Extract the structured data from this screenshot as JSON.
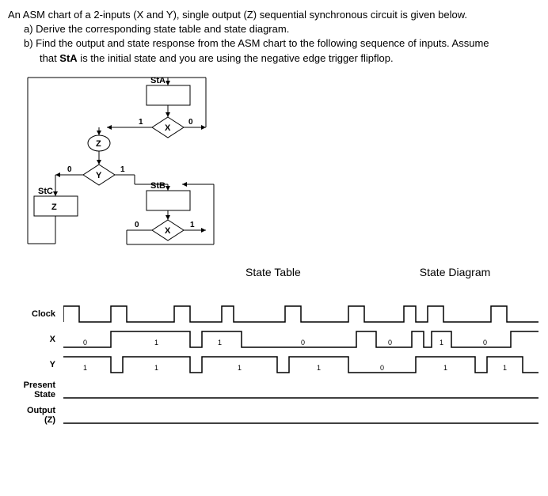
{
  "header": {
    "intro": "An ASM chart of a 2-inputs (X and Y), single output (Z) sequential synchronous circuit is given below.",
    "item_a": "a) Derive the corresponding state table and state diagram.",
    "item_b": "b) Find the output and state response from the ASM chart to the following sequence of inputs. Assume",
    "item_b_cont": "that StA is the initial state and you are using the negative edge trigger flipflop."
  },
  "asm": {
    "state_a": "StA",
    "state_b": "StB",
    "state_c": "StC",
    "output_z": "Z",
    "input_x": "X",
    "input_y": "Y",
    "zero": "0",
    "one": "1"
  },
  "labels": {
    "state_table": "State Table",
    "state_diagram": "State Diagram"
  },
  "timing": {
    "clock_label": "Clock",
    "x_label": "X",
    "y_label": "Y",
    "present_state_label_1": "Present",
    "present_state_label_2": "State",
    "output_label_1": "Output",
    "output_label_2": "(Z)",
    "x_values": [
      "0",
      "1",
      "1",
      "0",
      "0",
      "1",
      "0"
    ],
    "y_values": [
      "1",
      "1",
      "1",
      "1",
      "0",
      "1",
      "1"
    ]
  }
}
